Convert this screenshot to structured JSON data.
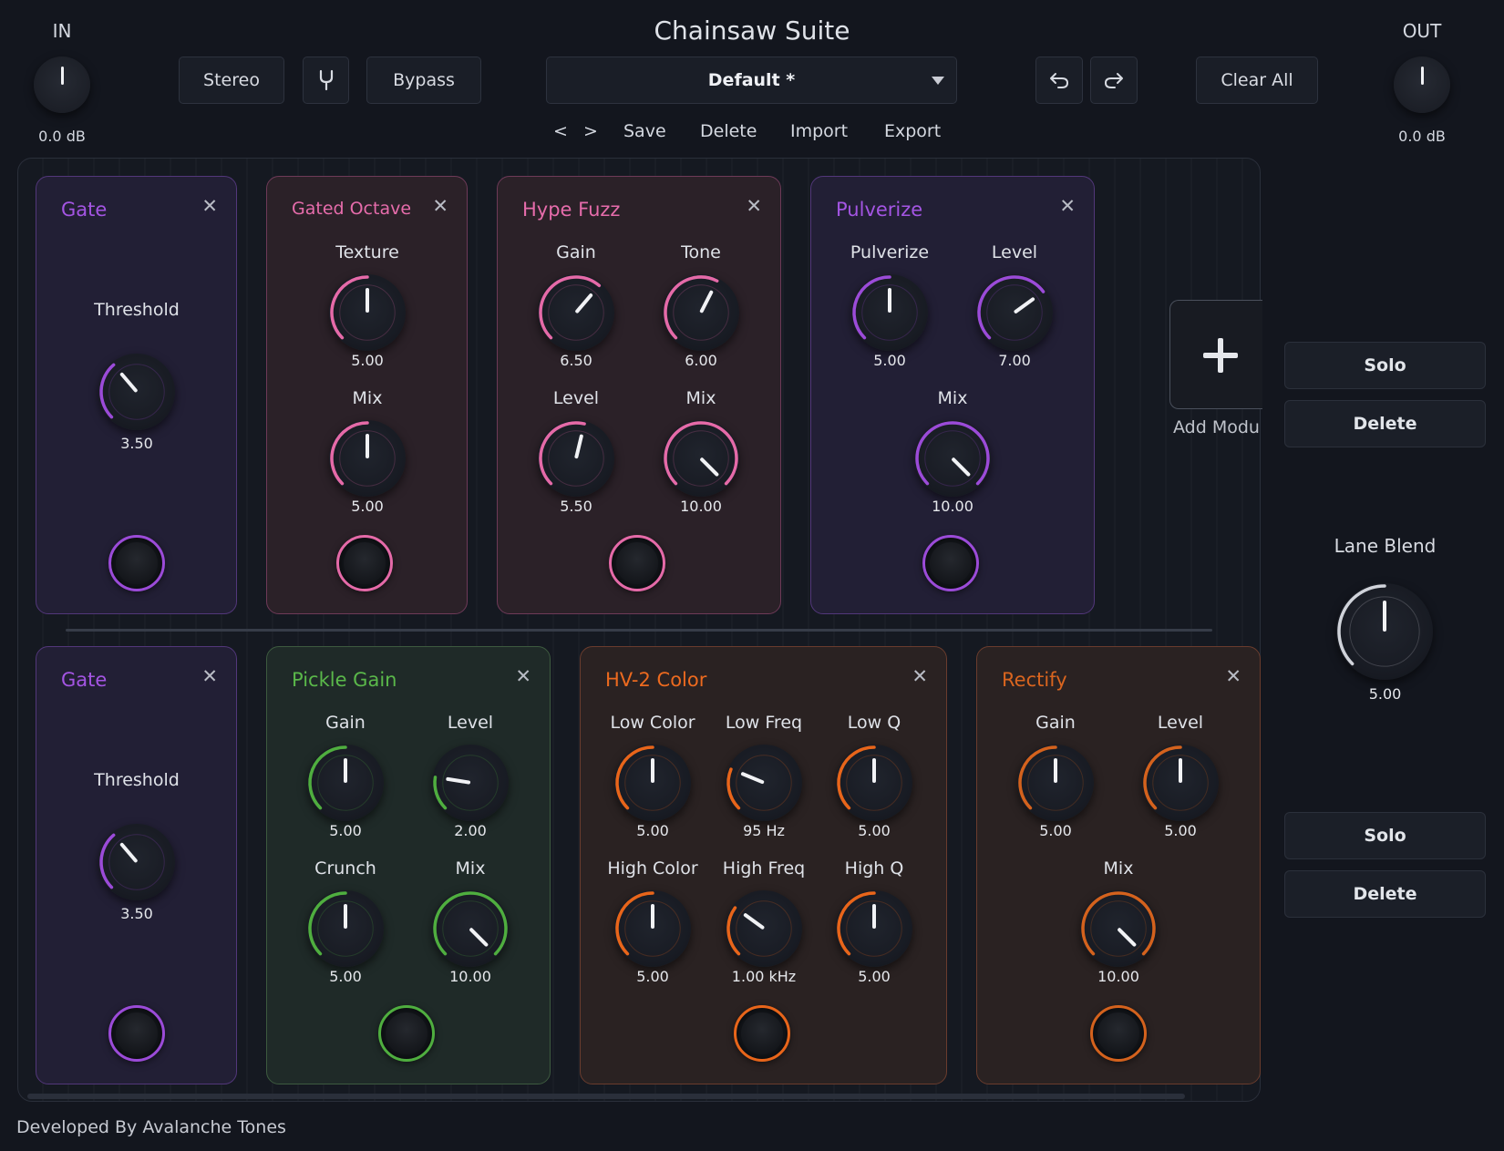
{
  "app": {
    "title": "Chainsaw Suite",
    "footer": "Developed By Avalanche Tones"
  },
  "input": {
    "label": "IN",
    "value": "0.0 dB"
  },
  "output": {
    "label": "OUT",
    "value": "0.0 dB"
  },
  "toolbar": {
    "stereo": "Stereo",
    "fork_icon": "fork-icon",
    "bypass": "Bypass",
    "preset": "Default *",
    "undo_icon": "undo-icon",
    "redo_icon": "redo-icon",
    "clear_all": "Clear All"
  },
  "preset_nav": {
    "prev": "<",
    "next": ">",
    "save": "Save",
    "delete": "Delete",
    "import": "Import",
    "export": "Export"
  },
  "add_module": {
    "label": "Add Module",
    "icon": "plus-icon"
  },
  "lane_blend": {
    "label": "Lane Blend",
    "value": "5.00",
    "level": 0.5
  },
  "lanes": [
    {
      "solo": "Solo",
      "delete": "Delete",
      "modules": [
        {
          "title": "Gate",
          "knobs": [
            {
              "label": "Threshold",
              "value": "3.50",
              "level": 0.35
            }
          ]
        },
        {
          "title": "Gated Octave",
          "knobs": [
            {
              "label": "Texture",
              "value": "5.00",
              "level": 0.5
            },
            {
              "label": "Mix",
              "value": "5.00",
              "level": 0.5
            }
          ]
        },
        {
          "title": "Hype Fuzz",
          "knobs": [
            {
              "label": "Gain",
              "value": "6.50",
              "level": 0.65
            },
            {
              "label": "Tone",
              "value": "6.00",
              "level": 0.6
            },
            {
              "label": "Level",
              "value": "5.50",
              "level": 0.55
            },
            {
              "label": "Mix",
              "value": "10.00",
              "level": 1.0
            }
          ]
        },
        {
          "title": "Pulverize",
          "knobs": [
            {
              "label": "Pulverize",
              "value": "5.00",
              "level": 0.5
            },
            {
              "label": "Level",
              "value": "7.00",
              "level": 0.7
            },
            {
              "label": "Mix",
              "value": "10.00",
              "level": 1.0
            }
          ]
        }
      ]
    },
    {
      "solo": "Solo",
      "delete": "Delete",
      "modules": [
        {
          "title": "Gate",
          "knobs": [
            {
              "label": "Threshold",
              "value": "3.50",
              "level": 0.35
            }
          ]
        },
        {
          "title": "Pickle Gain",
          "knobs": [
            {
              "label": "Gain",
              "value": "5.00",
              "level": 0.5
            },
            {
              "label": "Level",
              "value": "2.00",
              "level": 0.2
            },
            {
              "label": "Crunch",
              "value": "5.00",
              "level": 0.5
            },
            {
              "label": "Mix",
              "value": "10.00",
              "level": 1.0
            }
          ]
        },
        {
          "title": "HV-2 Color",
          "knobs": [
            {
              "label": "Low Color",
              "value": "5.00",
              "level": 0.5
            },
            {
              "label": "Low Freq",
              "value": "95 Hz",
              "level": 0.25
            },
            {
              "label": "Low Q",
              "value": "5.00",
              "level": 0.5
            },
            {
              "label": "High Color",
              "value": "5.00",
              "level": 0.5
            },
            {
              "label": "High Freq",
              "value": "1.00 kHz",
              "level": 0.3
            },
            {
              "label": "High Q",
              "value": "5.00",
              "level": 0.5
            }
          ]
        },
        {
          "title": "Rectify",
          "knobs": [
            {
              "label": "Gain",
              "value": "5.00",
              "level": 0.5
            },
            {
              "label": "Level",
              "value": "5.00",
              "level": 0.5
            },
            {
              "label": "Mix",
              "value": "10.00",
              "level": 1.0
            }
          ]
        }
      ]
    }
  ],
  "colors": {
    "gate": "#9b4bd8",
    "gated_octave": "#e56aa8",
    "hype_fuzz": "#e56aa8",
    "pulverize": "#9b4bd8",
    "pickle_gain": "#4fae3f",
    "hv2_color": "#e8651a",
    "rectify": "#d4621d"
  }
}
